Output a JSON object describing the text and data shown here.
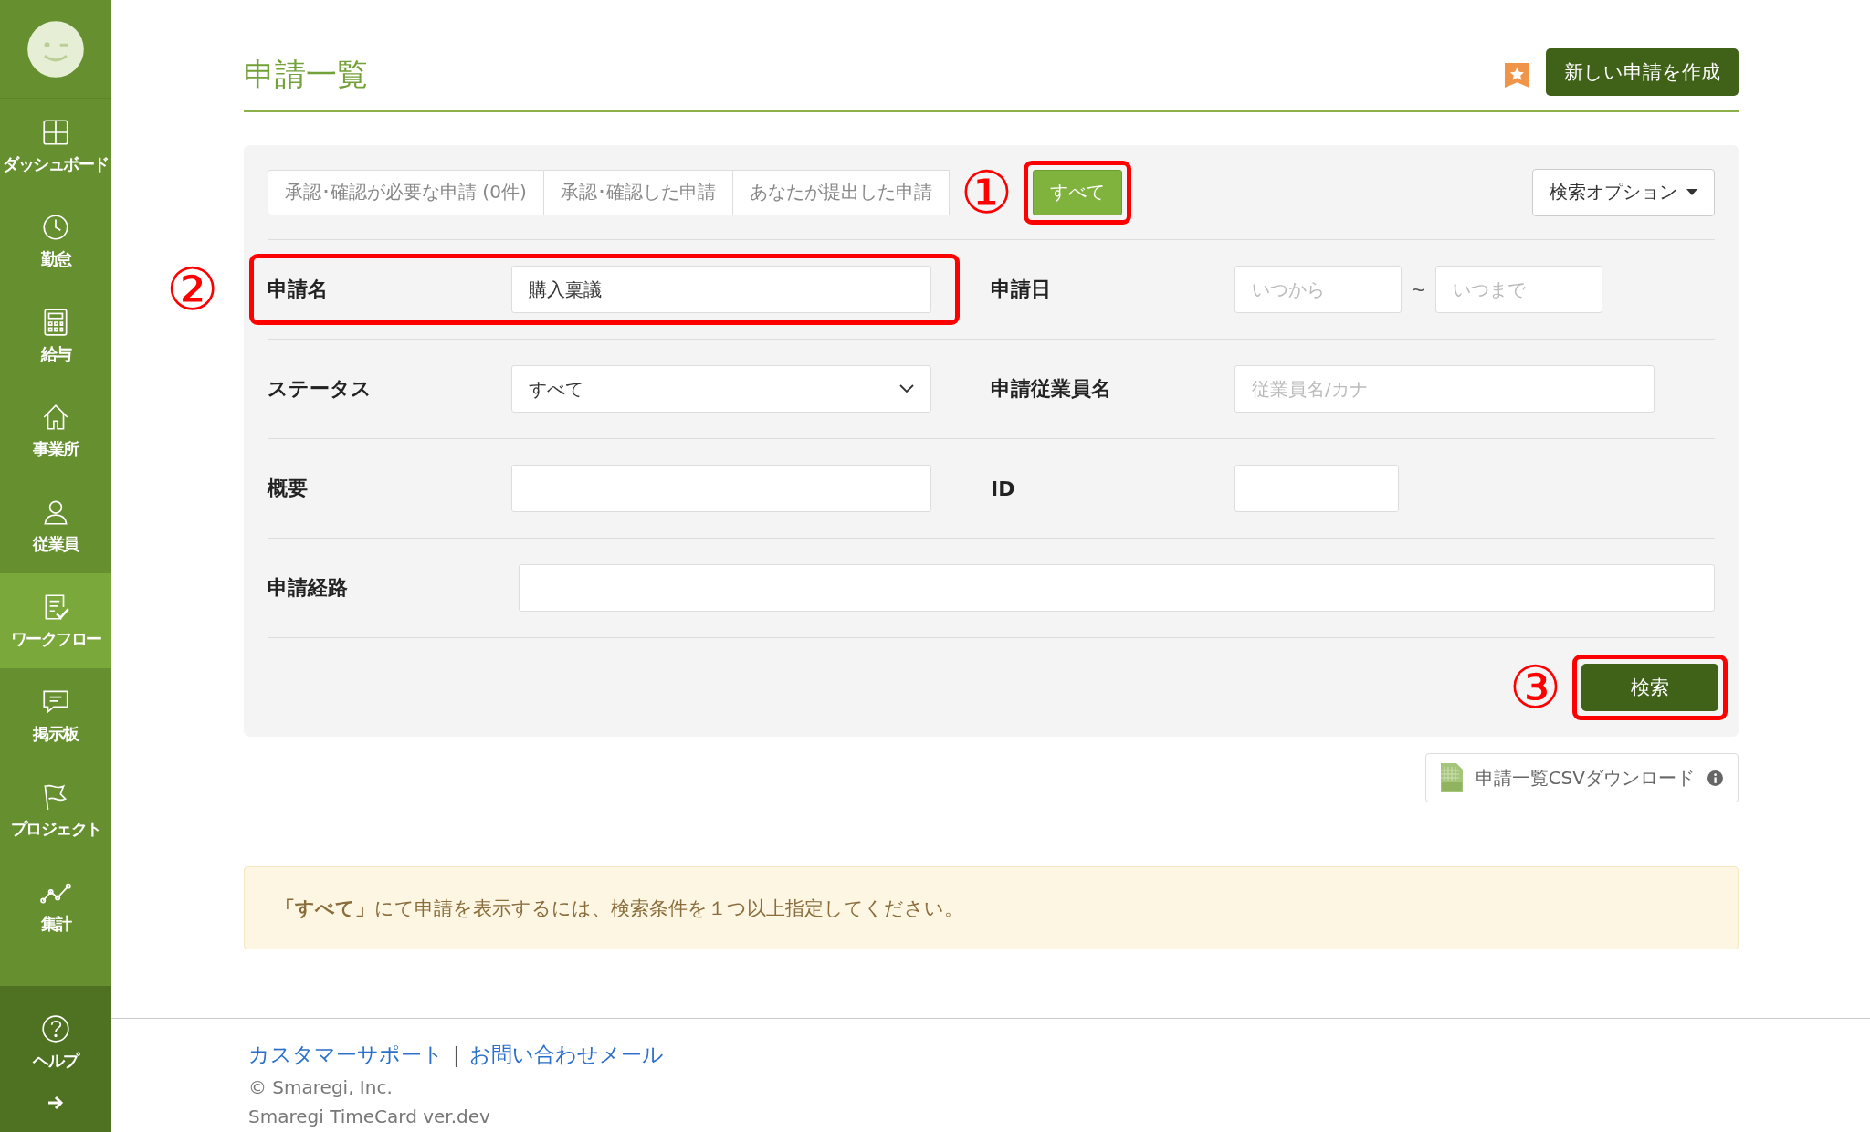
{
  "sidebar": {
    "items": [
      {
        "label": "ダッシュボード",
        "selected": false
      },
      {
        "label": "勤怠",
        "selected": false
      },
      {
        "label": "給与",
        "selected": false
      },
      {
        "label": "事業所",
        "selected": false
      },
      {
        "label": "従業員",
        "selected": false
      },
      {
        "label": "ワークフロー",
        "selected": true
      },
      {
        "label": "掲示板",
        "selected": false
      },
      {
        "label": "プロジェクト",
        "selected": false
      },
      {
        "label": "集計",
        "selected": false
      }
    ],
    "help": {
      "label": "ヘルプ"
    }
  },
  "title": "申請一覧",
  "new_button": "新しい申請を作成",
  "tabs": [
    {
      "label": "承認･確認が必要な申請 (0件)",
      "selected": false,
      "highlight": false
    },
    {
      "label": "承認･確認した申請",
      "selected": false,
      "highlight": false
    },
    {
      "label": "あなたが提出した申請",
      "selected": false,
      "highlight": false
    },
    {
      "label": "すべて",
      "selected": true,
      "highlight": true
    }
  ],
  "tab_annotation": "①",
  "search_options": "検索オプション",
  "rows": [
    {
      "highlight": true,
      "annotation": "②",
      "fields": [
        {
          "kind": "text",
          "label": "申請名",
          "value": "購入稟議"
        },
        {
          "kind": "range",
          "label": "申請日",
          "from_placeholder": "いつから",
          "separator": "~",
          "to_placeholder": "いつまで"
        }
      ]
    },
    {
      "highlight": false,
      "fields": [
        {
          "kind": "select",
          "label": "ステータス",
          "value": "すべて"
        },
        {
          "kind": "text",
          "label": "申請従業員名",
          "placeholder": "従業員名/カナ"
        }
      ]
    },
    {
      "highlight": false,
      "fields": [
        {
          "kind": "text",
          "label": "概要"
        },
        {
          "kind": "short",
          "label": "ID"
        }
      ]
    },
    {
      "highlight": false,
      "fields": [
        {
          "kind": "wide",
          "label": "申請経路"
        }
      ]
    }
  ],
  "search_button": {
    "label": "検索",
    "highlight": true,
    "annotation": "③"
  },
  "csv_button": "申請一覧CSVダウンロード",
  "notice": "**「すべて」**にて申請を表示するには、検索条件を１つ以上指定してください。",
  "footer": {
    "links": [
      "カスタマーサポート",
      "お問い合わせメール"
    ],
    "separator": "|",
    "copyright": "© Smaregi, Inc.",
    "version": "Smaregi TimeCard ver.dev"
  }
}
